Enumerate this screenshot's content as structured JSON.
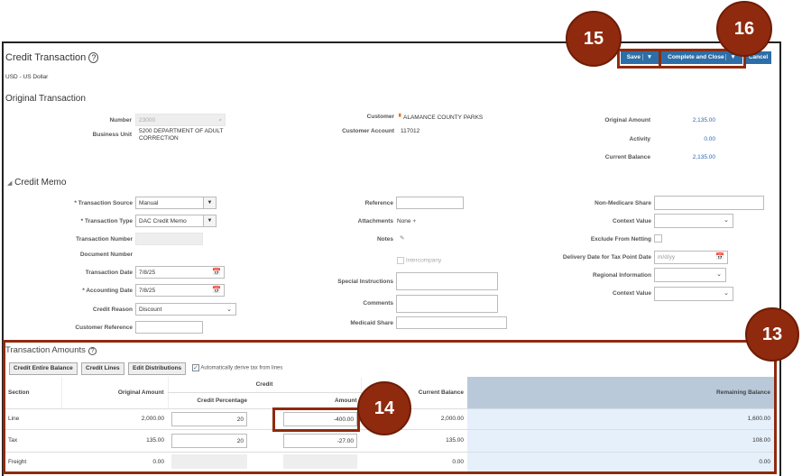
{
  "header": {
    "title": "Credit Transaction",
    "currency": "USD - US Dollar",
    "save": "Save",
    "complete_close": "Complete and Close",
    "cancel": "Cancel"
  },
  "original": {
    "title": "Original Transaction",
    "number_label": "Number",
    "number": "23000",
    "bu_label": "Business Unit",
    "bu": "5200 DEPARTMENT OF ADULT CORRECTION",
    "customer_label": "Customer",
    "customer": "ALAMANCE COUNTY PARKS",
    "account_label": "Customer Account",
    "account": "117012",
    "orig_amount_label": "Original Amount",
    "orig_amount": "2,135.00",
    "activity_label": "Activity",
    "activity": "0.00",
    "cur_bal_label": "Current Balance",
    "cur_bal": "2,135.00"
  },
  "memo": {
    "title": "Credit Memo",
    "source_label": "Transaction Source",
    "source": "Manual",
    "type_label": "Transaction Type",
    "type": "DAC Credit Memo",
    "txn_number_label": "Transaction Number",
    "doc_number_label": "Document Number",
    "txn_date_label": "Transaction Date",
    "txn_date": "7/8/25",
    "acct_date_label": "Accounting Date",
    "acct_date": "7/8/25",
    "reason_label": "Credit Reason",
    "reason": "Discount",
    "cust_ref_label": "Customer Reference",
    "reference_label": "Reference",
    "attachments_label": "Attachments",
    "attachments": "None",
    "notes_label": "Notes",
    "intercompany": "Intercompany",
    "special_label": "Special Instructions",
    "comments_label": "Comments",
    "medicaid_label": "Medicaid Share",
    "nonmed_label": "Non-Medicare Share",
    "context_label": "Context Value",
    "exclude_label": "Exclude From Netting",
    "delivery_label": "Delivery Date for Tax Point Date",
    "delivery_placeholder": "m/d/yy",
    "regional_label": "Regional Information",
    "context2_label": "Context Value"
  },
  "amounts": {
    "title": "Transaction Amounts",
    "btn_entire": "Credit Entire Balance",
    "btn_lines": "Credit Lines",
    "btn_dist": "Edit Distributions",
    "auto_tax": "Automatically derive tax from lines",
    "headers": {
      "section": "Section",
      "original": "Original Amount",
      "credit": "Credit",
      "pct": "Credit Percentage",
      "amount": "Amount",
      "current": "Current Balance",
      "remaining": "Remaining Balance"
    },
    "rows": [
      {
        "section": "Line",
        "original": "2,000.00",
        "pct": "20",
        "amount": "-400.00",
        "current": "2,000.00",
        "remaining": "1,600.00"
      },
      {
        "section": "Tax",
        "original": "135.00",
        "pct": "20",
        "amount": "-27.00",
        "current": "135.00",
        "remaining": "108.00"
      },
      {
        "section": "Freight",
        "original": "0.00",
        "pct": "",
        "amount": "",
        "current": "0.00",
        "remaining": "0.00"
      }
    ]
  },
  "callouts": {
    "c13": "13",
    "c14": "14",
    "c15": "15",
    "c16": "16"
  }
}
